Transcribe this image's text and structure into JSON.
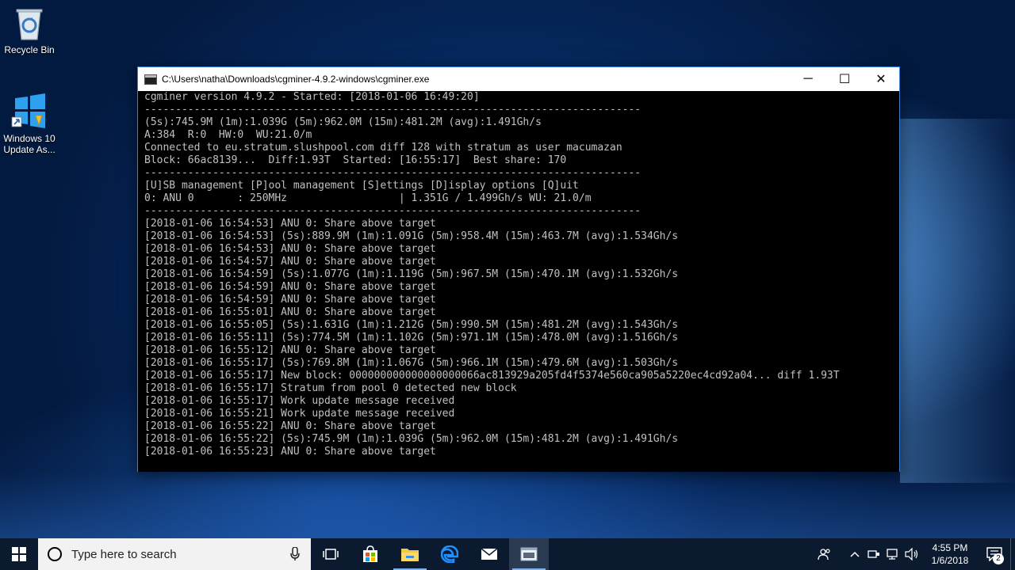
{
  "desktop": {
    "icons": [
      {
        "label": "Recycle Bin"
      },
      {
        "label": "Windows 10 Update As..."
      }
    ]
  },
  "window": {
    "title": "C:\\Users\\natha\\Downloads\\cgminer-4.9.2-windows\\cgminer.exe",
    "controls": {
      "minimize": "─",
      "maximize": "☐",
      "close": "✕"
    },
    "lines": [
      "cgminer version 4.9.2 - Started: [2018-01-06 16:49:20]",
      "--------------------------------------------------------------------------------",
      "(5s):745.9M (1m):1.039G (5m):962.0M (15m):481.2M (avg):1.491Gh/s",
      "A:384  R:0  HW:0  WU:21.0/m",
      "Connected to eu.stratum.slushpool.com diff 128 with stratum as user macumazan",
      "Block: 66ac8139...  Diff:1.93T  Started: [16:55:17]  Best share: 170",
      "--------------------------------------------------------------------------------",
      "[U]SB management [P]ool management [S]ettings [D]isplay options [Q]uit",
      "0: ANU 0       : 250MHz                  | 1.351G / 1.499Gh/s WU: 21.0/m",
      "--------------------------------------------------------------------------------",
      "[2018-01-06 16:54:53] ANU 0: Share above target",
      "[2018-01-06 16:54:53] (5s):889.9M (1m):1.091G (5m):958.4M (15m):463.7M (avg):1.534Gh/s",
      "[2018-01-06 16:54:53] ANU 0: Share above target",
      "[2018-01-06 16:54:57] ANU 0: Share above target",
      "[2018-01-06 16:54:59] (5s):1.077G (1m):1.119G (5m):967.5M (15m):470.1M (avg):1.532Gh/s",
      "[2018-01-06 16:54:59] ANU 0: Share above target",
      "[2018-01-06 16:54:59] ANU 0: Share above target",
      "[2018-01-06 16:55:01] ANU 0: Share above target",
      "[2018-01-06 16:55:05] (5s):1.631G (1m):1.212G (5m):990.5M (15m):481.2M (avg):1.543Gh/s",
      "[2018-01-06 16:55:11] (5s):774.5M (1m):1.102G (5m):971.1M (15m):478.0M (avg):1.516Gh/s",
      "[2018-01-06 16:55:12] ANU 0: Share above target",
      "[2018-01-06 16:55:17] (5s):769.8M (1m):1.067G (5m):966.1M (15m):479.6M (avg):1.503Gh/s",
      "[2018-01-06 16:55:17] New block: 000000000000000000066ac813929a205fd4f5374e560ca905a5220ec4cd92a04... diff 1.93T",
      "[2018-01-06 16:55:17] Stratum from pool 0 detected new block",
      "[2018-01-06 16:55:17] Work update message received",
      "[2018-01-06 16:55:21] Work update message received",
      "[2018-01-06 16:55:22] ANU 0: Share above target",
      "[2018-01-06 16:55:22] (5s):745.9M (1m):1.039G (5m):962.0M (15m):481.2M (avg):1.491Gh/s",
      "[2018-01-06 16:55:23] ANU 0: Share above target"
    ]
  },
  "taskbar": {
    "search_placeholder": "Type here to search",
    "apps": [
      "task-view",
      "store",
      "file-explorer",
      "edge",
      "mail",
      "cgminer-console"
    ],
    "clock": {
      "time": "4:55 PM",
      "date": "1/6/2018"
    },
    "notification_count": "2"
  },
  "colors": {
    "console_bg": "#000000",
    "console_text": "#c0c0c0",
    "window_border": "#3a7fd5",
    "taskbar_bg": "#0c1a2f"
  }
}
